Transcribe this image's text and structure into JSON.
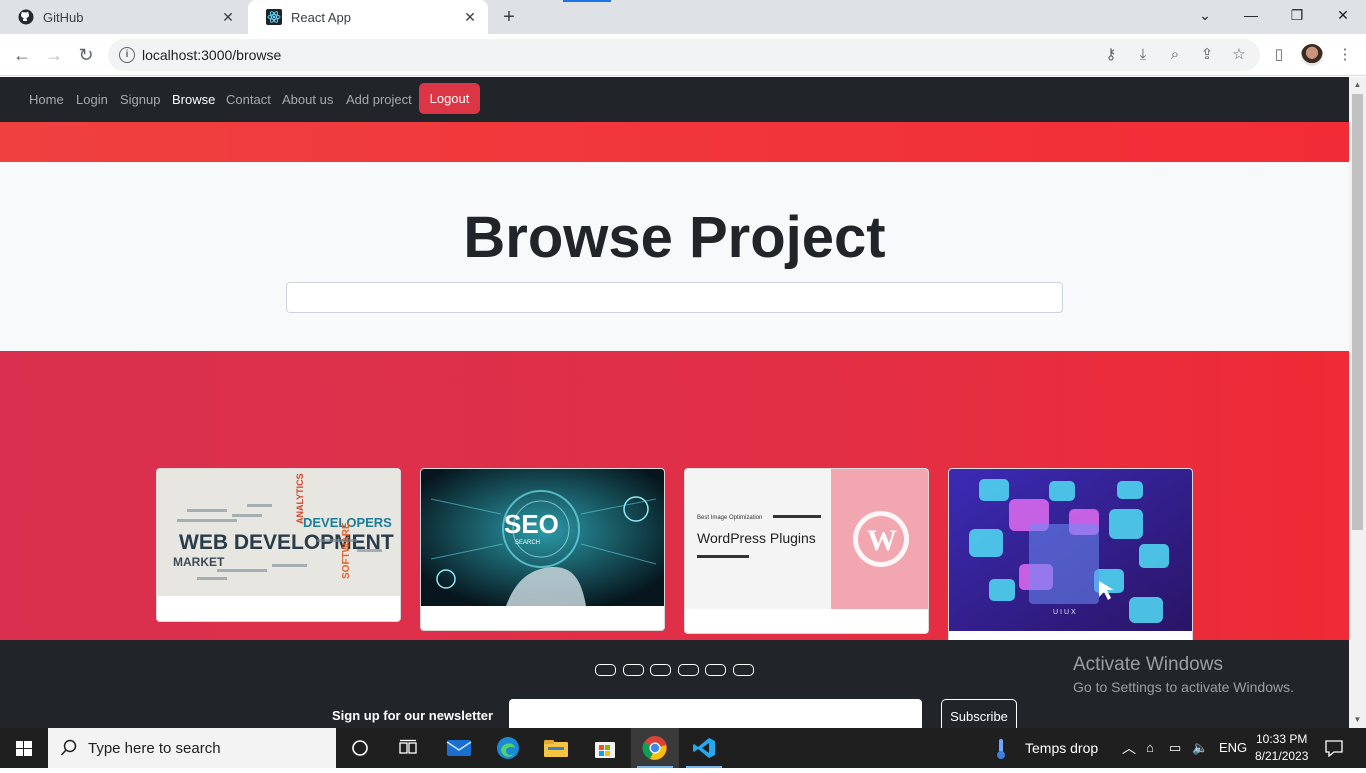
{
  "browser": {
    "tabs": [
      {
        "title": "GitHub",
        "icon": "github-icon"
      },
      {
        "title": "React App",
        "icon": "react-icon",
        "active": true
      }
    ],
    "new_tab": "+",
    "close_glyph": "✕",
    "url": "localhost:3000/browse",
    "window_controls": {
      "collapse": "⌄",
      "minimize": "—",
      "restore": "❐",
      "close": "✕"
    }
  },
  "navbar": {
    "links": [
      "Home",
      "Login",
      "Signup",
      "Browse",
      "Contact",
      "About us",
      "Add project"
    ],
    "active": "Browse",
    "logout_label": "Logout"
  },
  "hero": {
    "title": "Browse Project",
    "search_value": ""
  },
  "cards": [
    {
      "image": "web-development-word-cloud",
      "words": [
        "WEB DEVELOPMENT",
        "DEVELOPERS",
        "MARKET",
        "SOFTWARE",
        "ANALYTICS"
      ]
    },
    {
      "image": "seo-hand-graphic",
      "words": [
        "SEO",
        "SEARCH"
      ]
    },
    {
      "image": "wordpress-plugins-graphic",
      "words": [
        "Best Image Optimization",
        "WordPress Plugins"
      ]
    },
    {
      "image": "uiux-illustration",
      "words": [
        "UIUX"
      ]
    }
  ],
  "footer": {
    "social_buttons": 6,
    "newsletter_label": "Sign up for our newsletter",
    "newsletter_value": "",
    "subscribe_label": "Subscribe",
    "watermark": {
      "line1": "Activate Windows",
      "line2": "Go to Settings to activate Windows."
    }
  },
  "taskbar": {
    "search_placeholder": "Type here to search",
    "weather": "Temps drop",
    "language": "ENG",
    "time": "10:33 PM",
    "date": "8/21/2023",
    "apps": [
      "cortana-icon",
      "task-view-icon",
      "mail-icon",
      "edge-icon",
      "file-explorer-icon",
      "store-icon",
      "chrome-icon",
      "vscode-icon"
    ]
  },
  "colors": {
    "navbar_bg": "#212529",
    "logout_bg": "#dc3545",
    "hero_bg": "#f8f9fa",
    "accent_red": "#f22c36",
    "cards_bg_start": "#d9304f"
  }
}
